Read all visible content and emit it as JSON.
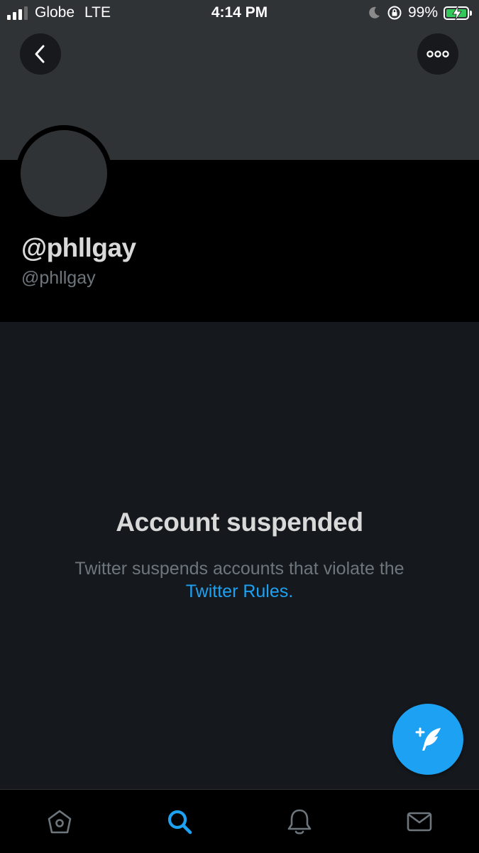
{
  "status_bar": {
    "carrier": "Globe",
    "network": "LTE",
    "time": "4:14 PM",
    "battery_percent": "99%",
    "battery_level": 0.99,
    "icons": [
      "signal-icon",
      "moon-icon",
      "orientation-lock-icon",
      "battery-charging-icon"
    ]
  },
  "header": {
    "back_icon": "chevron-left-icon",
    "more_icon": "more-horizontal-icon"
  },
  "profile": {
    "display_name": "@phllgay",
    "handle": "@phllgay"
  },
  "suspension": {
    "title": "Account suspended",
    "message": "Twitter suspends accounts that violate the",
    "link": "Twitter Rules",
    "link_suffix": "."
  },
  "fab": {
    "icon": "compose-tweet-icon"
  },
  "tab_bar": {
    "tabs": [
      {
        "icon": "home-icon",
        "active": false
      },
      {
        "icon": "search-icon",
        "active": true
      },
      {
        "icon": "bell-icon",
        "active": false
      },
      {
        "icon": "mail-icon",
        "active": false
      }
    ]
  },
  "colors": {
    "accent": "#1da1f2",
    "banner": "#2f3336",
    "background": "#15181c",
    "text_primary": "#d9d9d9",
    "text_secondary": "#6e767d",
    "battery": "#34c759"
  }
}
